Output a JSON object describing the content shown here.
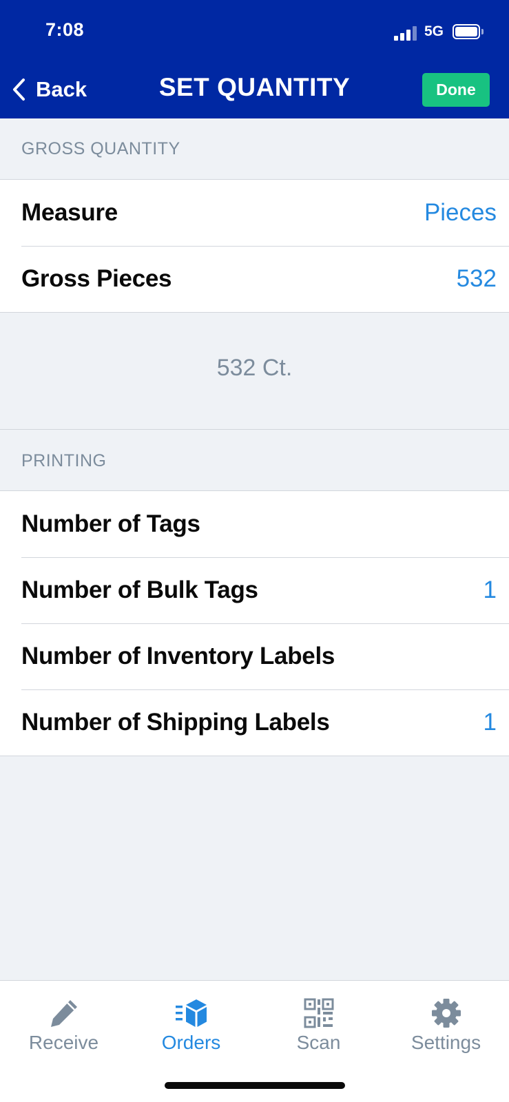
{
  "status_bar": {
    "time": "7:08",
    "network": "5G"
  },
  "nav": {
    "back_label": "Back",
    "title": "SET QUANTITY",
    "done_label": "Done"
  },
  "gross_section": {
    "header": "GROSS QUANTITY",
    "rows": [
      {
        "label": "Measure",
        "value": "Pieces"
      },
      {
        "label": "Gross Pieces",
        "value": "532"
      }
    ],
    "summary": "532 Ct."
  },
  "printing_section": {
    "header": "PRINTING",
    "rows": [
      {
        "label": "Number of Tags",
        "value": ""
      },
      {
        "label": "Number of Bulk Tags",
        "value": "1"
      },
      {
        "label": "Number of Inventory Labels",
        "value": ""
      },
      {
        "label": "Number of Shipping Labels",
        "value": "1"
      }
    ]
  },
  "tabbar": {
    "items": [
      {
        "label": "Receive",
        "icon": "pencil-icon",
        "active": false
      },
      {
        "label": "Orders",
        "icon": "orders-box-icon",
        "active": true
      },
      {
        "label": "Scan",
        "icon": "qr-code-icon",
        "active": false
      },
      {
        "label": "Settings",
        "icon": "gear-icon",
        "active": false
      }
    ]
  },
  "colors": {
    "header_bg": "#0028a3",
    "done_button": "#18c281",
    "accent_value": "#2489e0",
    "section_text": "#7c8c9c",
    "background": "#eff2f6"
  }
}
